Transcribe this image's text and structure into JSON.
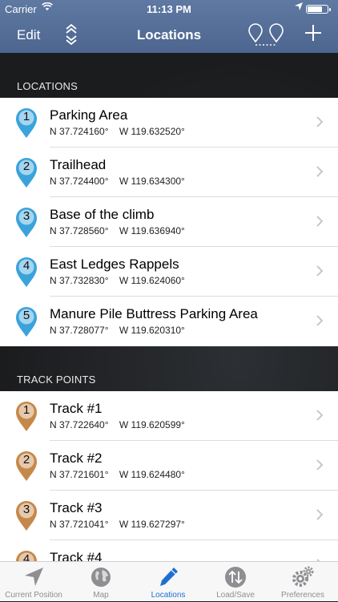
{
  "status_bar": {
    "carrier": "Carrier",
    "time": "11:13 PM"
  },
  "nav": {
    "edit_label": "Edit",
    "title": "Locations"
  },
  "sections": {
    "locations_header": "LOCATIONS",
    "locations": [
      {
        "number": "1",
        "name": "Parking Area",
        "lat": "N 37.724160°",
        "lon": "W 119.632520°"
      },
      {
        "number": "2",
        "name": "Trailhead",
        "lat": "N 37.724400°",
        "lon": "W 119.634300°"
      },
      {
        "number": "3",
        "name": "Base of the climb",
        "lat": "N 37.728560°",
        "lon": "W 119.636940°"
      },
      {
        "number": "4",
        "name": "East Ledges Rappels",
        "lat": "N 37.732830°",
        "lon": "W 119.624060°"
      },
      {
        "number": "5",
        "name": "Manure Pile Buttress Parking Area",
        "lat": "N 37.728077°",
        "lon": "W 119.620310°"
      }
    ],
    "tracks_header": "TRACK POINTS",
    "tracks": [
      {
        "number": "1",
        "name": "Track #1",
        "lat": "N 37.722640°",
        "lon": "W 119.620599°"
      },
      {
        "number": "2",
        "name": "Track #2",
        "lat": "N 37.721601°",
        "lon": "W 119.624480°"
      },
      {
        "number": "3",
        "name": "Track #3",
        "lat": "N 37.721041°",
        "lon": "W 119.627297°"
      },
      {
        "number": "4",
        "name": "Track #4",
        "lat": "",
        "lon": ""
      }
    ]
  },
  "tabbar": {
    "tabs": [
      {
        "label": "Current Position",
        "icon": "location-arrow-icon"
      },
      {
        "label": "Map",
        "icon": "globe-icon"
      },
      {
        "label": "Locations",
        "icon": "pen-icon"
      },
      {
        "label": "Load/Save",
        "icon": "up-down-arrows-icon"
      },
      {
        "label": "Preferences",
        "icon": "gears-icon"
      }
    ],
    "active_index": 2
  },
  "colors": {
    "nav_bar": "#5a7299",
    "location_pin": "#3aa3dc",
    "track_pin": "#c6884a",
    "active_tab": "#1f6fd1",
    "inactive_tab": "#8e8e93"
  }
}
